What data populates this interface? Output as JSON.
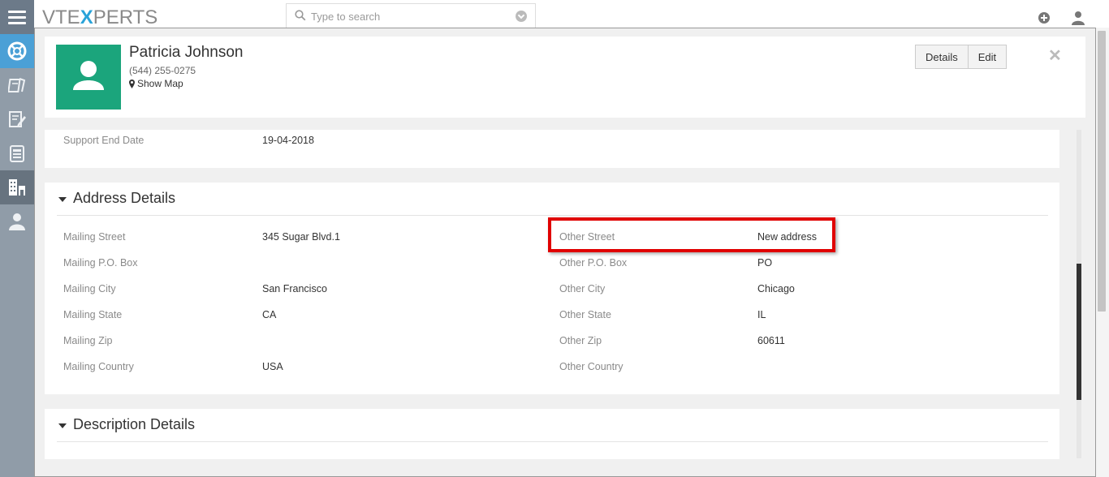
{
  "topbar": {
    "logo_left": "VTE",
    "logo_x": "X",
    "logo_right": "PERTS",
    "search_placeholder": "Type to search"
  },
  "sidebar": {
    "items": [
      "support-icon",
      "tickets-icon",
      "notes-icon",
      "documents-icon",
      "organizations-icon",
      "contacts-icon"
    ]
  },
  "record": {
    "name": "Patricia Johnson",
    "phone": "(544) 255-0275",
    "show_map": "Show Map",
    "details_button": "Details",
    "edit_button": "Edit",
    "close": "✕"
  },
  "support": {
    "end_date_label": "Support End Date",
    "end_date_value": "19-04-2018"
  },
  "address": {
    "title": "Address Details",
    "left": [
      {
        "label": "Mailing Street",
        "value": "345 Sugar Blvd.1"
      },
      {
        "label": "Mailing P.O. Box",
        "value": ""
      },
      {
        "label": "Mailing City",
        "value": "San Francisco"
      },
      {
        "label": "Mailing State",
        "value": "CA"
      },
      {
        "label": "Mailing Zip",
        "value": ""
      },
      {
        "label": "Mailing Country",
        "value": "USA"
      }
    ],
    "right": [
      {
        "label": "Other Street",
        "value": "New address"
      },
      {
        "label": "Other P.O. Box",
        "value": "PO"
      },
      {
        "label": "Other City",
        "value": "Chicago"
      },
      {
        "label": "Other State",
        "value": "IL"
      },
      {
        "label": "Other Zip",
        "value": "60611"
      },
      {
        "label": "Other Country",
        "value": ""
      }
    ]
  },
  "description": {
    "title": "Description Details"
  },
  "colors": {
    "avatar": "#1ba57c",
    "highlight": "#e00000",
    "sidebar": "#909ca8",
    "sidebar_active": "#4ba0d6"
  }
}
